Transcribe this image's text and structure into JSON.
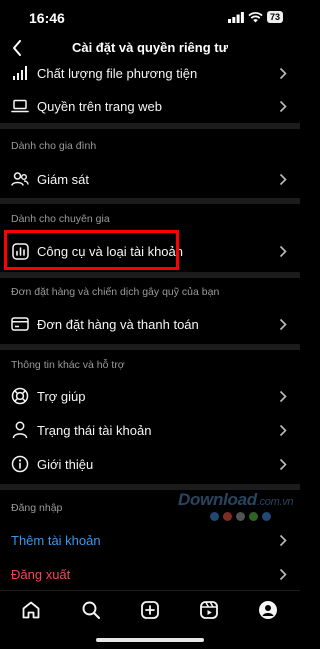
{
  "status_bar": {
    "time": "16:46",
    "battery": "73"
  },
  "header": {
    "title": "Cài đặt và quyền riêng tư"
  },
  "rows_top": [
    {
      "label": "Chất lượng file phương tiện",
      "icon": "signal-bars-icon"
    },
    {
      "label": "Quyền trên trang web",
      "icon": "laptop-icon"
    }
  ],
  "sections": {
    "family": {
      "header": "Dành cho gia đình",
      "items": [
        {
          "label": "Giám sát",
          "icon": "supervision-icon"
        }
      ]
    },
    "professional": {
      "header": "Dành cho chuyên gia",
      "items": [
        {
          "label": "Công cụ và loại tài khoản",
          "icon": "insights-chart-icon"
        }
      ]
    },
    "orders": {
      "header": "Đơn đặt hàng và chiến dịch gây quỹ của bạn",
      "items": [
        {
          "label": "Đơn đặt hàng và thanh toán",
          "icon": "card-icon"
        }
      ]
    },
    "info": {
      "header": "Thông tin khác và hỗ trợ",
      "items": [
        {
          "label": "Trợ giúp",
          "icon": "help-lifebuoy-icon"
        },
        {
          "label": "Trạng thái tài khoản",
          "icon": "person-icon"
        },
        {
          "label": "Giới thiệu",
          "icon": "info-icon"
        }
      ]
    },
    "login": {
      "header": "Đăng nhập",
      "items": [
        {
          "label": "Thêm tài khoản",
          "color": "#3897f0"
        },
        {
          "label": "Đăng xuất",
          "color": "#ed4956"
        }
      ]
    }
  },
  "watermark": {
    "main": "Download",
    "suffix": ".com.vn"
  },
  "tab_bar": [
    "home-icon",
    "search-icon",
    "create-icon",
    "reels-icon",
    "profile-icon"
  ],
  "colors": {
    "background": "#000000",
    "divider": "#1c1c1c",
    "highlight": "#ff0000",
    "link_blue": "#3897f0",
    "logout_red": "#ed4956"
  }
}
